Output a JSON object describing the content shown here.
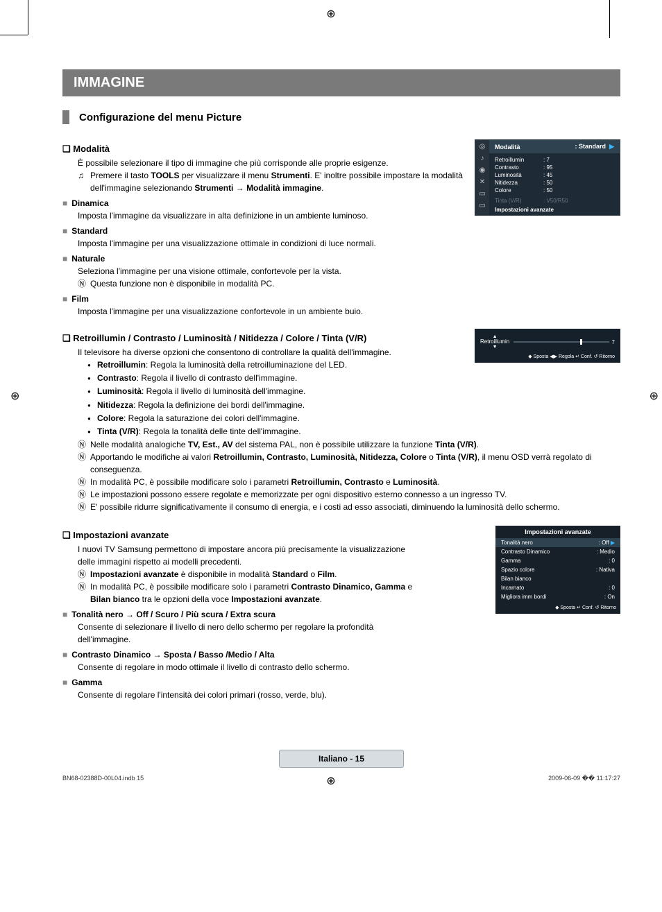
{
  "header": {
    "title": "IMMAGINE",
    "subtitle": "Configurazione del menu Picture"
  },
  "sec1": {
    "title": "Modalità",
    "intro": "È possibile selezionare il tipo di immagine che più corrisponde alle proprie esigenze.",
    "tools_a": "Premere il tasto ",
    "tools_b": "TOOLS",
    "tools_c": " per visualizzare il menu ",
    "tools_d": "Strumenti",
    "tools_e": ". E' inoltre possibile impostare la modalità dell'immagine selezionando ",
    "tools_f": "Strumenti → Modalità immagine",
    "tools_g": ".",
    "dinamica_h": "Dinamica",
    "dinamica_b": "Imposta l'immagine da visualizzare in alta definizione in un ambiente luminoso.",
    "standard_h": "Standard",
    "standard_b": "Imposta l'immagine per una visualizzazione ottimale in condizioni di luce normali.",
    "naturale_h": "Naturale",
    "naturale_b": "Seleziona l'immagine per una visione ottimale, confortevole per la vista.",
    "naturale_n": "Questa funzione non è disponibile in modalità PC.",
    "film_h": "Film",
    "film_b": "Imposta l'immagine per una visualizzazione confortevole in un ambiente buio."
  },
  "osd1": {
    "header_l": "Modalità",
    "header_r": ": Standard",
    "rows": [
      {
        "k": "Retroillumin",
        "v": ": 7"
      },
      {
        "k": "Contrasto",
        "v": ": 95"
      },
      {
        "k": "Luminosità",
        "v": ": 45"
      },
      {
        "k": "Nitidezza",
        "v": ": 50"
      },
      {
        "k": "Colore",
        "v": ": 50"
      }
    ],
    "dim": {
      "k": "Tinta (V/R)",
      "v": ": V50/R50"
    },
    "last": "Impostazioni avanzate"
  },
  "sec2": {
    "title": "Retroillumin / Contrasto / Luminosità / Nitidezza / Colore / Tinta (V/R)",
    "intro": "Il televisore ha diverse opzioni che consentono di controllare la qualità dell'immagine.",
    "b1a": "Retroillumin",
    "b1b": ": Regola la luminosità della retroilluminazione del LED.",
    "b2a": "Contrasto",
    "b2b": ": Regola il livello di contrasto dell'immagine.",
    "b3a": "Luminosità",
    "b3b": ": Regola il livello di luminosità dell'immagine.",
    "b4a": "Nitidezza",
    "b4b": ": Regola la definizione dei bordi dell'immagine.",
    "b5a": "Colore",
    "b5b": ": Regola la saturazione dei colori dell'immagine.",
    "b6a": "Tinta (V/R)",
    "b6b": ": Regola la tonalità delle tinte dell'immagine.",
    "n1a": "Nelle modalità analogiche ",
    "n1b": "TV, Est., AV",
    "n1c": " del sistema PAL, non è possibile utilizzare la funzione ",
    "n1d": "Tinta (V/R)",
    "n1e": ".",
    "n2a": "Apportando le modifiche ai valori ",
    "n2b": "Retroillumin, Contrasto, Luminosità, Nitidezza, Colore",
    "n2c": " o ",
    "n2d": "Tinta (V/R)",
    "n2e": ", il menu OSD verrà regolato di conseguenza.",
    "n3a": "In modalità PC, è possibile modificare solo i parametri ",
    "n3b": "Retroillumin, Contrasto",
    "n3c": " e ",
    "n3d": "Luminosità",
    "n3e": ".",
    "n4": "Le impostazioni possono essere regolate e memorizzate per ogni dispositivo esterno connesso a un ingresso TV.",
    "n5": "E' possibile ridurre significativamente il consumo di energia, e i costi ad esso associati, diminuendo la luminosità dello schermo."
  },
  "osd2": {
    "label": "Retroillumin",
    "value": "7",
    "foot": "◆ Sposta   ◀▶ Regola   ↵ Conf.   ↺ Ritorno"
  },
  "sec3": {
    "title": "Impostazioni avanzate",
    "intro": "I nuovi TV Samsung permettono di impostare ancora più precisamente la visualizzazione delle immagini rispetto ai modelli precedenti.",
    "n1a": "Impostazioni avanzate",
    "n1b": " è disponibile in modalità ",
    "n1c": "Standard",
    "n1d": " o ",
    "n1e": "Film",
    "n1f": ".",
    "n2a": "In modalità PC, è possibile modificare solo i parametri ",
    "n2b": "Contrasto Dinamico, Gamma",
    "n2c": " e ",
    "n2d": "Bilan bianco",
    "n2e": " tra le opzioni della voce ",
    "n2f": "Impostazioni avanzate",
    "n2g": ".",
    "ton_h": "Tonalità nero → Off / Scuro / Più scura / Extra scura",
    "ton_b": "Consente di selezionare il livello di nero dello schermo per regolare la profondità dell'immagine.",
    "cd_h": "Contrasto Dinamico → Sposta / Basso /Medio / Alta",
    "cd_b": "Consente di regolare in modo ottimale il livello di contrasto dello schermo.",
    "g_h": "Gamma",
    "g_b": "Consente di regolare l'intensità dei colori primari (rosso, verde, blu)."
  },
  "osd3": {
    "title": "Impostazioni avanzate",
    "rows": [
      {
        "k": "Tonalità nero",
        "v": ": Off",
        "sel": true
      },
      {
        "k": "Contrasto Dinamico",
        "v": ": Medio"
      },
      {
        "k": "Gamma",
        "v": ": 0"
      },
      {
        "k": "Spazio colore",
        "v": ": Nativa"
      },
      {
        "k": "Bilan bianco",
        "v": ""
      },
      {
        "k": "Incarnato",
        "v": ": 0"
      },
      {
        "k": "Migliora imm bordi",
        "v": ": On"
      }
    ],
    "foot": "◆ Sposta   ↵ Conf.   ↺ Ritorno"
  },
  "footer": {
    "pill": "Italiano - 15",
    "left": "BN68-02388D-00L04.indb   15",
    "right": "2009-06-09   �� 11:17:27"
  }
}
